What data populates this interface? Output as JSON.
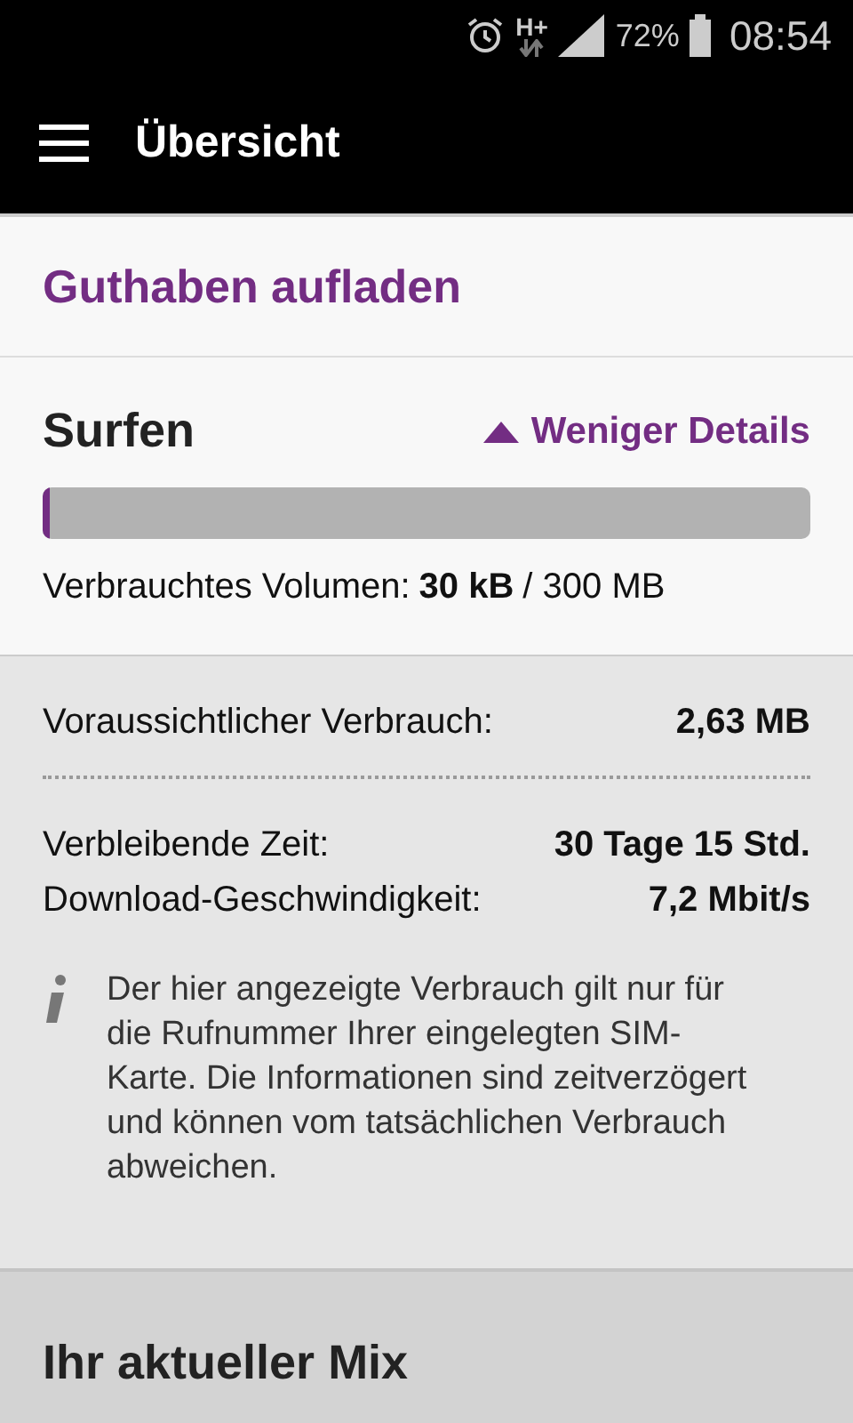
{
  "status_bar": {
    "network": "H+",
    "battery": "72%",
    "time": "08:54"
  },
  "app_bar": {
    "title": "Übersicht"
  },
  "top_up": {
    "label": "Guthaben aufladen"
  },
  "surfen": {
    "title": "Surfen",
    "toggle": "Weniger Details",
    "expanded": true,
    "usage": {
      "level": 0.01,
      "label": "Verbrauchtes Volumen:",
      "used": "30 kB",
      "total": "/ 300 MB"
    }
  },
  "details": [
    {
      "label": "Voraussichtlicher Verbrauch:",
      "value": "2,63 MB",
      "divider": true
    },
    {
      "label": "Verbleibende Zeit:",
      "value": "30 Tage 15 Std.",
      "divider": false
    },
    {
      "label": "Download-Geschwindigkeit:",
      "value": "7,2 Mbit/s",
      "divider": false
    }
  ],
  "info": "Der hier angezeigte Verbrauch gilt nur für die Rufnummer Ihrer eingelegten SIM-Karte. Die Informationen sind zeitverzögert und können vom tatsächlichen Verbrauch abweichen.",
  "mix": {
    "title": "Ihr aktueller Mix"
  }
}
